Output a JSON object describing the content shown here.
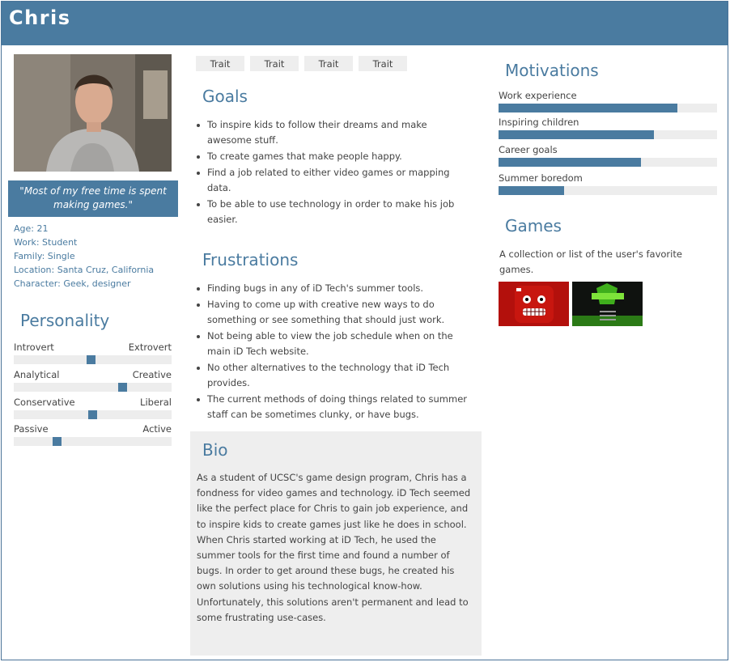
{
  "persona": {
    "name": "Chris",
    "quote": "\"Most of my free time is spent making games.\"",
    "facts": [
      "Age: 21",
      "Work: Student",
      "Family: Single",
      "Location: Santa Cruz, California",
      "Character: Geek, designer"
    ]
  },
  "personality": {
    "title": "Personality",
    "sliders": [
      {
        "left": "Introvert",
        "right": "Extrovert",
        "value": 0.49
      },
      {
        "left": "Analytical",
        "right": "Creative",
        "value": 0.7
      },
      {
        "left": "Conservative",
        "right": "Liberal",
        "value": 0.5
      },
      {
        "left": "Passive",
        "right": "Active",
        "value": 0.26
      }
    ]
  },
  "traits": [
    "Trait",
    "Trait",
    "Trait",
    "Trait"
  ],
  "goals": {
    "title": "Goals",
    "items": [
      "To inspire kids to follow their dreams and make awesome stuff.",
      "To create games that make people happy.",
      "Find a job related to either video games or mapping data.",
      "To be able to use technology in order to make his job easier."
    ]
  },
  "frustrations": {
    "title": "Frustrations",
    "items": [
      "Finding bugs in any of iD Tech's summer tools.",
      "Having to come up with creative new ways to do something or see something that should just work.",
      "Not being able to view the job schedule when on the main iD Tech website.",
      "No other alternatives to the technology that iD Tech provides.",
      "The current methods of doing things related to summer staff can be sometimes clunky, or have bugs."
    ]
  },
  "bio": {
    "title": "Bio",
    "text": "As a student of UCSC's game design program, Chris has a fondness for video games and technology. iD Tech seemed like the perfect place for Chris to gain job experience, and to inspire kids to create games just like he does in school. When Chris started working at iD Tech, he used the summer tools for the first time and found a number of bugs. In order to get around these bugs, he created his own solutions using his technological know-how. Unfortunately, this solutions aren't permanent and lead to some frustrating use-cases."
  },
  "motivations": {
    "title": "Motivations",
    "items": [
      {
        "label": "Work experience",
        "value": 0.82
      },
      {
        "label": "Inspiring children",
        "value": 0.71
      },
      {
        "label": "Career goals",
        "value": 0.65
      },
      {
        "label": "Summer boredom",
        "value": 0.3
      }
    ]
  },
  "games": {
    "title": "Games",
    "description": "A collection or list of the user's favorite games."
  },
  "colors": {
    "accent": "#4a7ba0",
    "panel": "#eeeeee"
  }
}
